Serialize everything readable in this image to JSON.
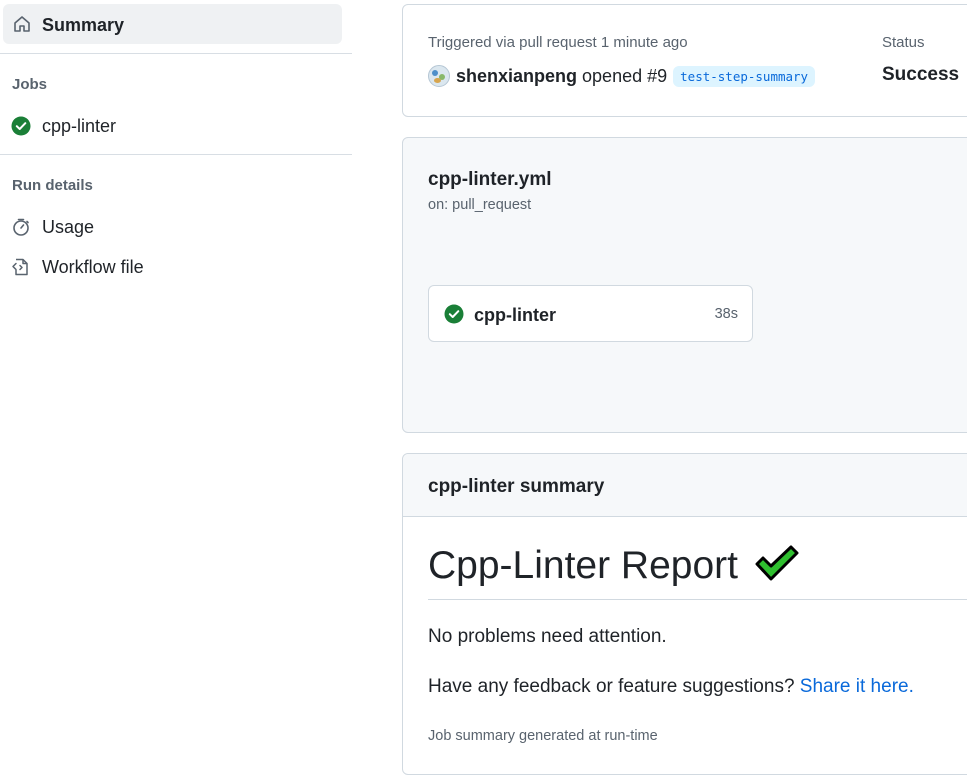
{
  "sidebar": {
    "summary_label": "Summary",
    "jobs_heading": "Jobs",
    "jobs": [
      {
        "label": "cpp-linter",
        "status": "success"
      }
    ],
    "run_details_heading": "Run details",
    "run_details": [
      {
        "label": "Usage",
        "icon": "stopwatch-icon"
      },
      {
        "label": "Workflow file",
        "icon": "file-code-icon"
      }
    ]
  },
  "run": {
    "triggered_text": "Triggered via pull request 1 minute ago",
    "actor": "shenxianpeng",
    "action": "opened",
    "pr_number": "#9",
    "branch": "test-step-summary",
    "status_label": "Status",
    "status_value": "Success"
  },
  "workflow": {
    "file": "cpp-linter.yml",
    "trigger": "on: pull_request",
    "job": {
      "name": "cpp-linter",
      "duration": "38s",
      "status": "success"
    }
  },
  "summary": {
    "header": "cpp-linter summary",
    "report_title": "Cpp-Linter Report",
    "report_icon": "heavy-check-mark-icon",
    "no_problems": "No problems need attention.",
    "feedback_text": "Have any feedback or feature suggestions?",
    "feedback_link": "Share it here.",
    "footer": "Job summary generated at run-time"
  },
  "colors": {
    "success": "#1a7f37",
    "link": "#0969da",
    "check_green": "#2fbf2f"
  }
}
